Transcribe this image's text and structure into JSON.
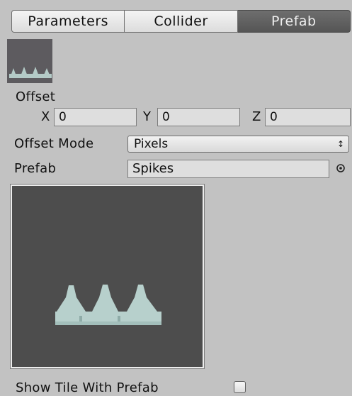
{
  "tabs": [
    {
      "label": "Parameters",
      "active": false
    },
    {
      "label": "Collider",
      "active": false
    },
    {
      "label": "Prefab",
      "active": true
    }
  ],
  "thumbnail": {
    "icon": "spikes-sprite-icon"
  },
  "offset": {
    "label": "Offset",
    "x": {
      "label": "X",
      "value": "0"
    },
    "y": {
      "label": "Y",
      "value": "0"
    },
    "z": {
      "label": "Z",
      "value": "0"
    }
  },
  "offset_mode": {
    "label": "Offset Mode",
    "value": "Pixels"
  },
  "prefab": {
    "label": "Prefab",
    "value": "Spikes",
    "picker_icon": "object-picker-icon"
  },
  "preview": {
    "icon": "spikes-preview-icon",
    "background": "#4d4d4d",
    "spike_color": "#b7d0cc"
  },
  "show_tile": {
    "label": "Show Tile With Prefab",
    "checked": false
  },
  "colors": {
    "active_tab": "#5f5f5f",
    "panel": "#c2c2c2"
  }
}
